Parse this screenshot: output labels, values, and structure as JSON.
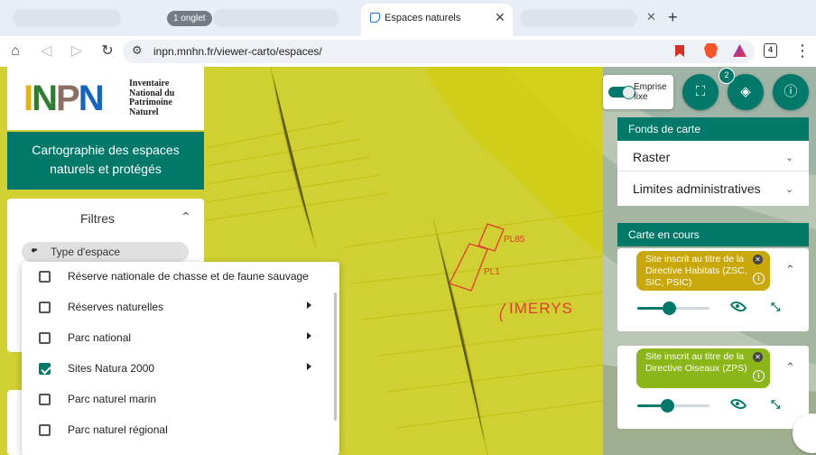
{
  "browser": {
    "tab_count_chip": "1 onglet",
    "active_tab": {
      "title": "Espaces naturels",
      "close": "✕"
    },
    "other_tab_close": "✕",
    "new_tab": "+",
    "url": "inpn.mnhn.fr/viewer-carto/espaces/",
    "tab_counter": "4",
    "icons": {
      "home": "home-icon",
      "back": "back-arrow-icon",
      "forward": "forward-arrow-icon",
      "reload": "reload-icon",
      "menu": "kebab-menu-icon"
    }
  },
  "logo": {
    "letters": [
      "I",
      "N",
      "P",
      "N"
    ],
    "lines": [
      "Inventaire",
      "National du",
      "Patrimoine",
      "Naturel"
    ]
  },
  "app_title": [
    "Cartographie des espaces",
    "naturels et protégés"
  ],
  "filters": {
    "title": "Filtres",
    "type_chip": "Type d'espace",
    "dropdown": [
      {
        "label": "Réserve nationale de chasse et de faune sauvage",
        "checked": false,
        "has_submenu": false
      },
      {
        "label": "Réserves naturelles",
        "checked": false,
        "has_submenu": true
      },
      {
        "label": "Parc national",
        "checked": false,
        "has_submenu": true
      },
      {
        "label": "Sites Natura 2000",
        "checked": true,
        "has_submenu": true
      },
      {
        "label": "Parc naturel marin",
        "checked": false,
        "has_submenu": false
      },
      {
        "label": "Parc naturel régional",
        "checked": false,
        "has_submenu": false
      }
    ]
  },
  "map_controls": {
    "emprise_label": [
      "Emprise",
      "fixe"
    ],
    "emprise_on": true,
    "layers_badge": "2"
  },
  "map_annotations": [
    "PL85",
    "PL1",
    "IMERYS"
  ],
  "fonds_de_carte": {
    "title": "Fonds de carte",
    "items": [
      "Raster",
      "Limites administratives"
    ]
  },
  "carte_en_cours": {
    "title": "Carte en cours",
    "layers": [
      {
        "label": "Site inscrit au titre de la Directive Habitats (ZSC, SIC, PSIC)",
        "color": "#c9a80c",
        "opacity": 0.45
      },
      {
        "label": "Site inscrit au titre de la Directive Oiseaux (ZPS)",
        "color": "#8ab61a",
        "opacity": 0.42
      }
    ]
  },
  "colors": {
    "accent": "#00796b",
    "natura_overlay": "#d8d400",
    "annotation_red": "#e53935"
  }
}
